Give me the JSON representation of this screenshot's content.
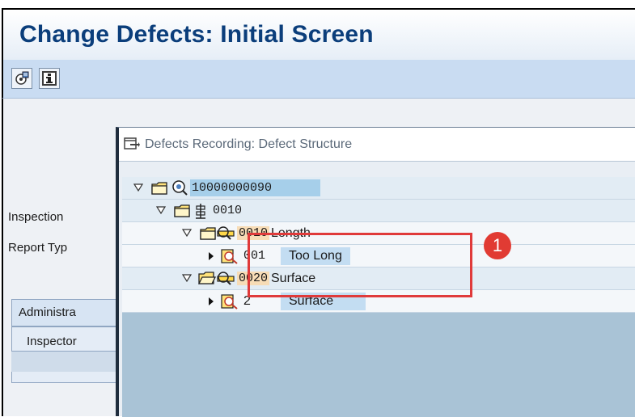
{
  "window": {
    "title": "Change Defects: Initial Screen"
  },
  "toolbar": {
    "buttons": [
      {
        "icon": "settings-icon"
      },
      {
        "icon": "info-icon"
      }
    ]
  },
  "background_form": {
    "inspection_label": "Inspection",
    "report_type_label": "Report Typ",
    "tab_label": "Administra",
    "inspector_label": "Inspector"
  },
  "dialog": {
    "title": "Defects Recording: Defect Structure",
    "tree": {
      "root": {
        "id": "10000000090"
      },
      "operation": {
        "id": "0010"
      },
      "characteristics": [
        {
          "id": "0010",
          "name": "Length",
          "defect": {
            "code": "001",
            "text": "Too Long"
          }
        },
        {
          "id": "0020",
          "name": "Surface",
          "defect": {
            "code": "2",
            "text": "Surface"
          }
        }
      ]
    }
  },
  "callout": {
    "number": "1"
  },
  "colors": {
    "title_text": "#0b3e7b",
    "toolbar_bg": "#c9dcf2",
    "callout_red": "#e03a3a"
  }
}
